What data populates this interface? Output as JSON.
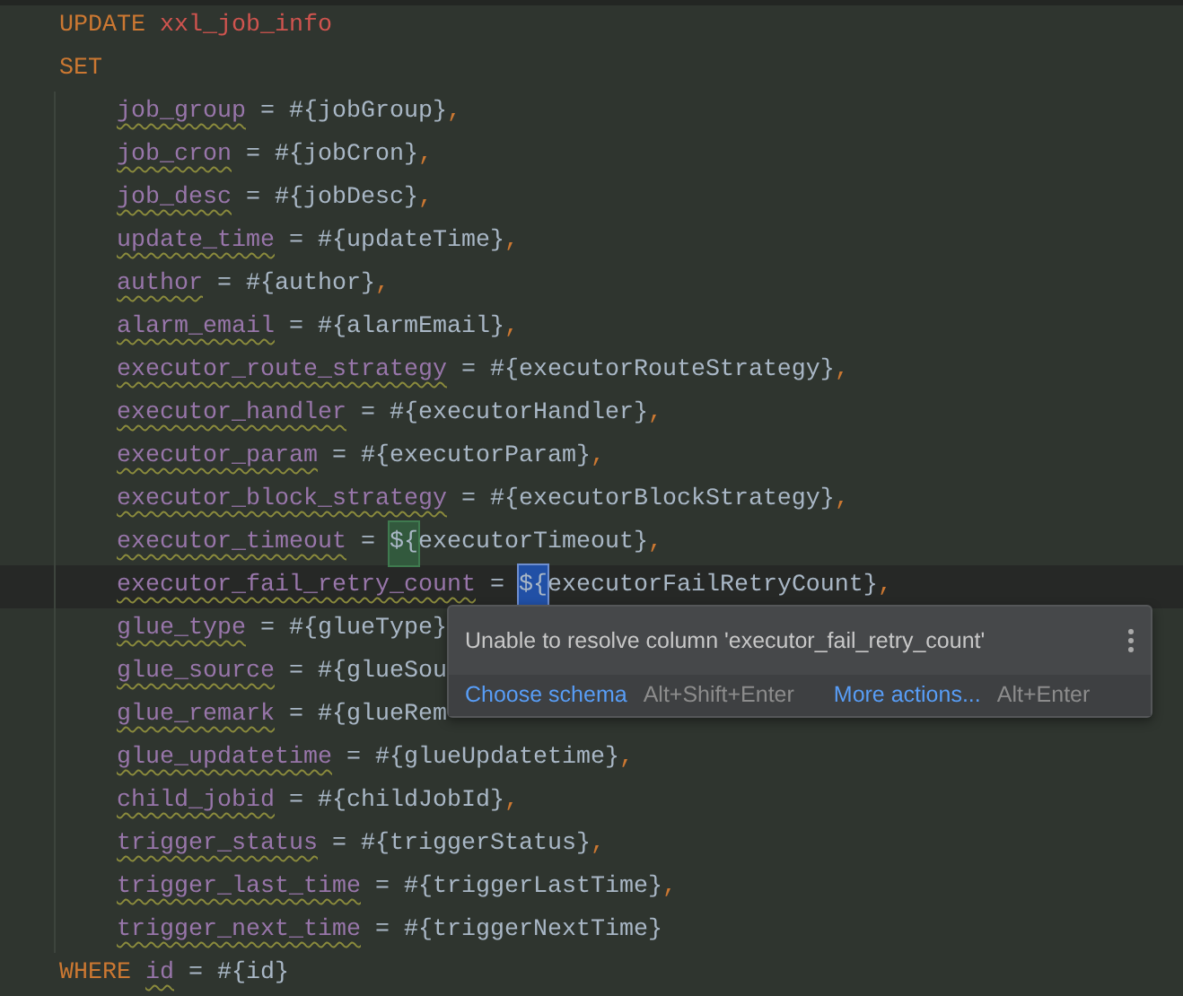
{
  "editor": {
    "lines": [
      {
        "kind": "update",
        "keyword": "UPDATE",
        "table": "xxl_job_info"
      },
      {
        "kind": "keyword",
        "keyword": "SET"
      },
      {
        "kind": "assign",
        "column": "job_group",
        "warning": true,
        "op": "=",
        "sigil": "#{",
        "value": "jobGroup}",
        "comma": ","
      },
      {
        "kind": "assign",
        "column": "job_cron",
        "warning": true,
        "op": "=",
        "sigil": "#{",
        "value": "jobCron}",
        "comma": ","
      },
      {
        "kind": "assign",
        "column": "job_desc",
        "warning": true,
        "op": "=",
        "sigil": "#{",
        "value": "jobDesc}",
        "comma": ","
      },
      {
        "kind": "assign",
        "column": "update_time",
        "warning": true,
        "op": "=",
        "sigil": "#{",
        "value": "updateTime}",
        "comma": ","
      },
      {
        "kind": "assign",
        "column": "author",
        "warning": true,
        "op": "=",
        "sigil": "#{",
        "value": "author}",
        "comma": ","
      },
      {
        "kind": "assign",
        "column": "alarm_email",
        "warning": true,
        "op": "=",
        "sigil": "#{",
        "value": "alarmEmail}",
        "comma": ","
      },
      {
        "kind": "assign",
        "column": "executor_route_strategy",
        "warning": true,
        "op": "=",
        "sigil": "#{",
        "value": "executorRouteStrategy}",
        "comma": ","
      },
      {
        "kind": "assign",
        "column": "executor_handler",
        "warning": true,
        "op": "=",
        "sigil": "#{",
        "value": "executorHandler}",
        "comma": ","
      },
      {
        "kind": "assign",
        "column": "executor_param",
        "warning": true,
        "op": "=",
        "sigil": "#{",
        "value": "executorParam}",
        "comma": ","
      },
      {
        "kind": "assign",
        "column": "executor_block_strategy",
        "warning": true,
        "op": "=",
        "sigil": "#{",
        "value": "executorBlockStrategy}",
        "comma": ","
      },
      {
        "kind": "assign",
        "column": "executor_timeout",
        "warning": true,
        "op": "=",
        "sigil": "${",
        "brace_match": true,
        "value": "executorTimeout}",
        "comma": ","
      },
      {
        "kind": "assign",
        "column": "executor_fail_retry_count",
        "warning": true,
        "current": true,
        "op": "=",
        "sigil": "${",
        "selected": true,
        "value": "executorFailRetryCount}",
        "comma": ","
      },
      {
        "kind": "assign",
        "column": "glue_type",
        "warning": true,
        "op": "=",
        "sigil": "#{",
        "value": "glueType}"
      },
      {
        "kind": "assign",
        "column": "glue_source",
        "warning": true,
        "op": "=",
        "sigil": "#{",
        "value": "glueSou"
      },
      {
        "kind": "assign",
        "column": "glue_remark",
        "warning": true,
        "op": "=",
        "sigil": "#{",
        "value": "glueRem"
      },
      {
        "kind": "assign",
        "column": "glue_updatetime",
        "warning": true,
        "op": "=",
        "sigil": "#{",
        "value": "glueUpdatetime}",
        "comma": ","
      },
      {
        "kind": "assign",
        "column": "child_jobid",
        "warning": true,
        "op": "=",
        "sigil": "#{",
        "value": "childJobId}",
        "comma": ","
      },
      {
        "kind": "assign",
        "column": "trigger_status",
        "warning": true,
        "op": "=",
        "sigil": "#{",
        "value": "triggerStatus}",
        "comma": ","
      },
      {
        "kind": "assign",
        "column": "trigger_last_time",
        "warning": true,
        "op": "=",
        "sigil": "#{",
        "value": "triggerLastTime}",
        "comma": ","
      },
      {
        "kind": "assign",
        "column": "trigger_next_time",
        "warning": true,
        "op": "=",
        "sigil": "#{",
        "value": "triggerNextTime}"
      },
      {
        "kind": "where",
        "keyword": "WHERE",
        "column": "id",
        "warning": true,
        "op": "=",
        "sigil": "#{",
        "value": "id}"
      }
    ]
  },
  "popup": {
    "message": "Unable to resolve column 'executor_fail_retry_count'",
    "actions": [
      {
        "label": "Choose schema",
        "shortcut": "Alt+Shift+Enter"
      },
      {
        "label": "More actions...",
        "shortcut": "Alt+Enter"
      }
    ]
  }
}
